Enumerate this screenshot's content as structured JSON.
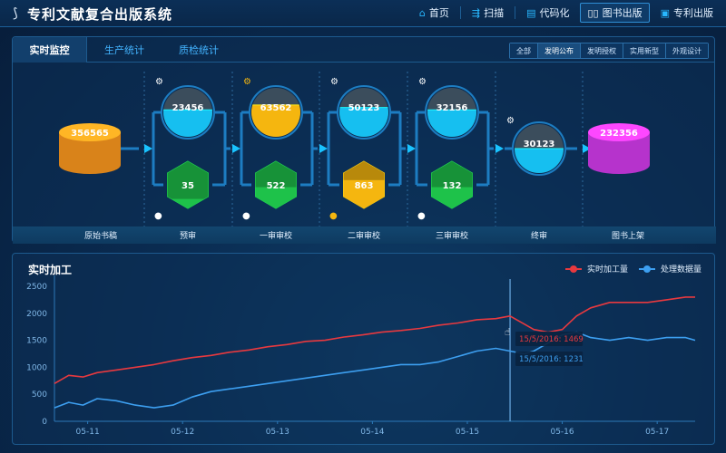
{
  "header": {
    "logo_icon": "feather-logo-icon",
    "title": "专利文献复合出版系统",
    "nav": [
      {
        "label": "首页",
        "icon": "home-icon",
        "active": false
      },
      {
        "label": "扫描",
        "icon": "scan-icon",
        "active": false
      },
      {
        "label": "代码化",
        "icon": "code-icon",
        "active": false
      },
      {
        "label": "图书出版",
        "icon": "book-icon",
        "active": true
      },
      {
        "label": "专利出版",
        "icon": "patent-icon",
        "active": false
      }
    ]
  },
  "monitor": {
    "tabs": [
      {
        "label": "实时监控",
        "active": true
      },
      {
        "label": "生产统计",
        "active": false
      },
      {
        "label": "质检统计",
        "active": false
      }
    ],
    "filters": [
      {
        "label": "全部",
        "active": false
      },
      {
        "label": "发明公布",
        "active": true
      },
      {
        "label": "发明授权",
        "active": false
      },
      {
        "label": "实用新型",
        "active": false
      },
      {
        "label": "外观设计",
        "active": false
      }
    ],
    "stages": [
      {
        "label": "原始书稿",
        "kind": "source",
        "value": "356565",
        "color": "#ff9a1f"
      },
      {
        "label": "预审",
        "kind": "process",
        "machine": "23456",
        "machine_color": "#16bff0",
        "machine_level": 0.55,
        "robot_color": "#ffffff",
        "person": "35",
        "person_color": "#1ec24a",
        "person_level": 0.2,
        "user_color": "#ffffff"
      },
      {
        "label": "一审审校",
        "kind": "process",
        "machine": "63562",
        "machine_color": "#f5b60f",
        "machine_level": 0.65,
        "robot_color": "#f5b60f",
        "person": "522",
        "person_color": "#1ec24a",
        "person_level": 0.45,
        "user_color": "#ffffff"
      },
      {
        "label": "二审审校",
        "kind": "process",
        "machine": "50123",
        "machine_color": "#16bff0",
        "machine_level": 0.6,
        "robot_color": "#ffffff",
        "person": "863",
        "person_color": "#f5b60f",
        "person_level": 0.6,
        "user_color": "#f5b60f"
      },
      {
        "label": "三审审校",
        "kind": "process",
        "machine": "32156",
        "machine_color": "#16bff0",
        "machine_level": 0.55,
        "robot_color": "#ffffff",
        "person": "132",
        "person_color": "#1ec24a",
        "person_level": 0.45,
        "user_color": "#ffffff"
      },
      {
        "label": "终审",
        "kind": "final",
        "machine": "30123",
        "machine_color": "#16bff0",
        "machine_level": 0.5,
        "robot_color": "#ffffff"
      },
      {
        "label": "图书上架",
        "kind": "sink",
        "value": "232356",
        "color": "#d63cf0"
      }
    ]
  },
  "realtime": {
    "title": "实时加工",
    "chart_data": {
      "type": "line",
      "ylim": [
        0,
        2600
      ],
      "yticks": [
        0,
        500,
        1000,
        1500,
        2000,
        2500
      ],
      "xticks": [
        "05-11",
        "05-12",
        "05-13",
        "05-14",
        "05-15",
        "05-16",
        "05-17"
      ],
      "xtick_pos": [
        0.5,
        1.5,
        2.5,
        3.5,
        4.5,
        5.5,
        6.5
      ],
      "xlim": [
        0.15,
        6.9
      ],
      "grid": false,
      "legend_position": "top-right",
      "series": [
        {
          "name": "实时加工量",
          "color": "#e8393f",
          "x": [
            0.15,
            0.3,
            0.45,
            0.6,
            0.8,
            1.0,
            1.2,
            1.4,
            1.6,
            1.8,
            2.0,
            2.2,
            2.4,
            2.6,
            2.8,
            3.0,
            3.2,
            3.4,
            3.6,
            3.8,
            4.0,
            4.2,
            4.4,
            4.6,
            4.8,
            4.95,
            5.1,
            5.2,
            5.35,
            5.5,
            5.65,
            5.8,
            6.0,
            6.2,
            6.4,
            6.6,
            6.8,
            6.9
          ],
          "y": [
            700,
            850,
            820,
            900,
            950,
            1000,
            1050,
            1120,
            1180,
            1220,
            1280,
            1320,
            1380,
            1420,
            1480,
            1500,
            1560,
            1600,
            1650,
            1680,
            1720,
            1780,
            1820,
            1880,
            1900,
            1950,
            1800,
            1700,
            1650,
            1700,
            1950,
            2100,
            2200,
            2200,
            2200,
            2250,
            2300,
            2300
          ]
        },
        {
          "name": "处理数据量",
          "color": "#3d9ff0",
          "x": [
            0.15,
            0.3,
            0.45,
            0.6,
            0.8,
            1.0,
            1.2,
            1.4,
            1.6,
            1.8,
            2.0,
            2.2,
            2.4,
            2.6,
            2.8,
            3.0,
            3.2,
            3.4,
            3.6,
            3.8,
            4.0,
            4.2,
            4.4,
            4.6,
            4.8,
            4.95,
            5.1,
            5.2,
            5.35,
            5.5,
            5.65,
            5.8,
            6.0,
            6.2,
            6.4,
            6.6,
            6.8,
            6.9
          ],
          "y": [
            250,
            350,
            300,
            420,
            380,
            300,
            250,
            300,
            450,
            550,
            600,
            650,
            700,
            750,
            800,
            850,
            900,
            950,
            1000,
            1050,
            1050,
            1100,
            1200,
            1300,
            1350,
            1300,
            1250,
            1300,
            1450,
            1600,
            1650,
            1550,
            1500,
            1550,
            1500,
            1550,
            1550,
            1500
          ]
        }
      ],
      "crosshair_x": 4.95,
      "tooltips": [
        {
          "text": "15/5/2016: 1469",
          "color": "#e8393f"
        },
        {
          "text": "15/5/2016: 1231",
          "color": "#3d9ff0"
        }
      ]
    }
  }
}
